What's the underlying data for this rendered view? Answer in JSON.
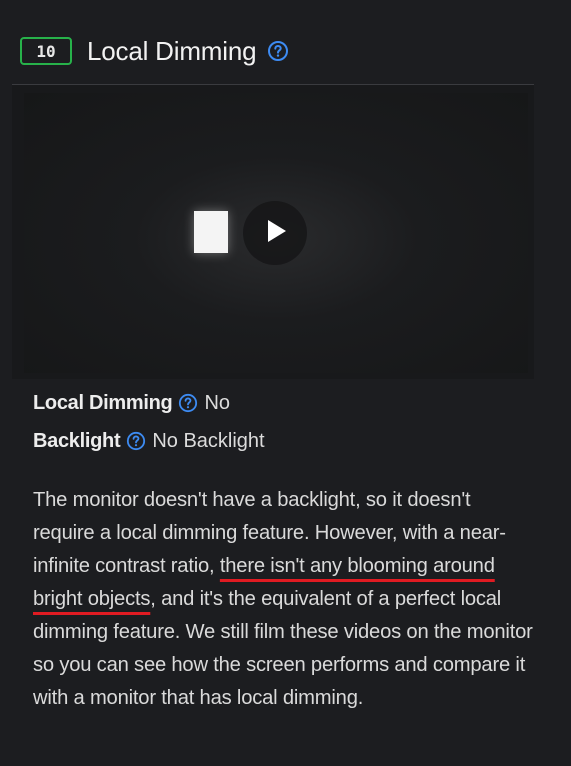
{
  "header": {
    "score": "10",
    "title": "Local Dimming",
    "help_icon": "question-circle-icon"
  },
  "video": {
    "play_icon": "play-icon"
  },
  "specs": [
    {
      "label": "Local Dimming",
      "value": "No"
    },
    {
      "label": "Backlight",
      "value": "No Backlight"
    }
  ],
  "description": {
    "part1": "The monitor doesn't have a backlight, so it doesn't require a local dimming feature. However, with a near-infinite contrast ratio, ",
    "highlight": "there isn't any blooming around bright objects",
    "part2": ", and it's the equivalent of a perfect local dimming feature. We still film these videos on the monitor so you can see how the screen performs and compare it with a monitor that has local dimming."
  },
  "colors": {
    "score_border": "#27b24a",
    "help_icon": "#3d8bf2",
    "highlight_underline": "#e01b22",
    "background": "#1c1d20"
  }
}
